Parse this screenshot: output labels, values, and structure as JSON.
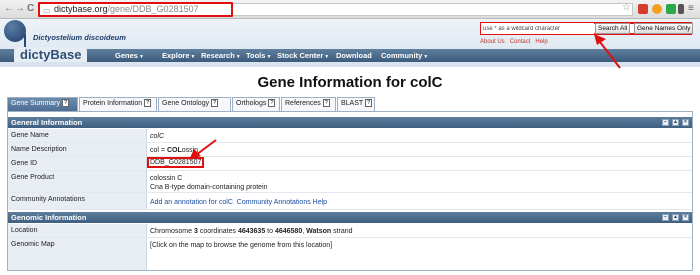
{
  "browser": {
    "back": "←",
    "forward": "→",
    "reload": "C",
    "url_host": "dictybase.org",
    "url_path": "/gene/DDB_G0281507",
    "menu": "≡"
  },
  "site": {
    "species": "Dictyostelium discoideum",
    "brand": "dictyBase",
    "nav": [
      "Genes",
      "Explore",
      "Research",
      "Tools",
      "Stock Center",
      "Download",
      "Community"
    ],
    "search": {
      "placeholder": "use * as a wildcard character",
      "search_all": "Search All",
      "gene_names_only": "Gene Names Only"
    },
    "top_links": [
      "About Us",
      "Contact",
      "Help"
    ]
  },
  "page": {
    "title": "Gene Information for colC",
    "tabs": [
      "Gene Summary",
      "Protein Information",
      "Gene Ontology",
      "Orthologs",
      "References",
      "BLAST"
    ],
    "tab_help": "?",
    "active_tab": "Gene Summary"
  },
  "general": {
    "header": "General Information",
    "rows": [
      {
        "label": "Gene Name",
        "value": "colC"
      },
      {
        "label": "Name Description",
        "value_pre": "col = ",
        "value_bold": "COL",
        "value_post": "ossin"
      },
      {
        "label": "Gene ID",
        "value": "DDB_G0281507"
      },
      {
        "label": "Gene Product",
        "value": "colossin C",
        "value2": "Cna B-type domain-containing protein"
      },
      {
        "label": "Community Annotations",
        "link1": "Add an annotation for colC",
        "link2": "Community Annotations Help"
      }
    ]
  },
  "genomic": {
    "header": "Genomic Information",
    "rows": [
      {
        "label": "Location",
        "pre": "Chromosome ",
        "chrom": "3",
        "mid": " coordinates ",
        "start": "4643635",
        "to": " to ",
        "end": "4646580",
        "sep": ", ",
        "strand": "Watson",
        "post": " strand"
      },
      {
        "label": "Genomic Map",
        "value": "[Click on the map to browse the genome from this location]"
      }
    ]
  },
  "controls": {
    "minus": "−",
    "up": "▲",
    "close": "×"
  },
  "colors": {
    "highlight": "#e01010",
    "nav": "#3c5b7c",
    "label_bg": "#e9eef4"
  }
}
